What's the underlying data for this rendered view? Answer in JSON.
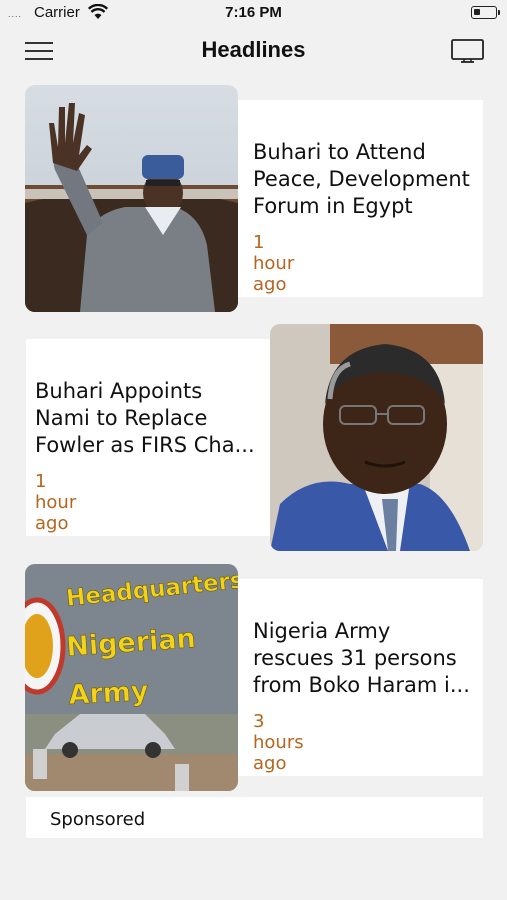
{
  "status_bar": {
    "signal": "....",
    "carrier": "Carrier",
    "time": "7:16 PM",
    "battery_level": 0.2
  },
  "nav": {
    "title": "Headlines",
    "menu_icon": "hamburger-menu-icon",
    "cast_icon": "tv-icon"
  },
  "articles": [
    {
      "title_lines": [
        "Buhari to Attend",
        "Peace, Development",
        "Forum in Egypt"
      ],
      "time": "1 hour ago"
    },
    {
      "title_lines": [
        "Buhari Appoints",
        "Nami to Replace",
        "Fowler as FIRS Cha..."
      ],
      "time": "1 hour ago"
    },
    {
      "title_lines": [
        "Nigeria Army",
        "rescues 31 persons",
        "from Boko Haram i..."
      ],
      "time": "3 hours ago"
    }
  ],
  "images": {
    "article3_sign_lines": [
      "Headquarters",
      "Nigerian",
      "Army"
    ]
  },
  "sponsored": {
    "label": "Sponsored"
  },
  "colors": {
    "background": "#f1f1f1",
    "card": "#ffffff",
    "timestamp": "#b5651d"
  }
}
